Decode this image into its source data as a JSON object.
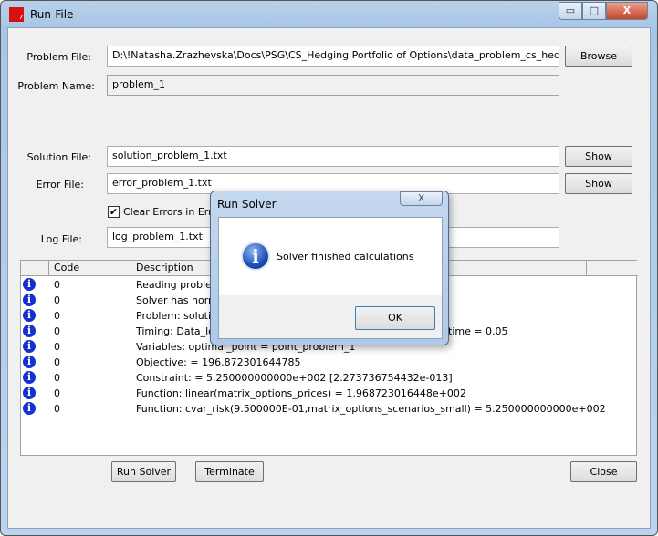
{
  "window": {
    "title": "Run-File",
    "controls": {
      "minimize": "▭",
      "maximize": "□",
      "close": "X"
    }
  },
  "form": {
    "problem_file": {
      "label": "Problem File:",
      "value": "D:\\!Natasha.Zrazhevska\\Docs\\PSG\\CS_Hedging Portfolio of Options\\data_problem_cs_hedging_portfolio"
    },
    "browse_label": "Browse",
    "problem_name": {
      "label": "Problem Name:",
      "value": "problem_1"
    },
    "solution_file": {
      "label": "Solution File:",
      "value": "solution_problem_1.txt"
    },
    "error_file": {
      "label": "Error File:",
      "value": "error_problem_1.txt"
    },
    "show_label": "Show",
    "clear_errors": {
      "label": "Clear Errors in Error",
      "checked": true
    },
    "log_file": {
      "label": "Log File:",
      "value": "log_problem_1.txt"
    }
  },
  "table": {
    "headers": [
      "",
      "Code",
      "Description",
      ""
    ],
    "rows": [
      {
        "icon": "info-icon",
        "code": "0",
        "description": "Reading problem"
      },
      {
        "icon": "info-icon",
        "code": "0",
        "description": "Solver has norma"
      },
      {
        "icon": "info-icon",
        "code": "0",
        "description": "Problem: solution"
      },
      {
        "icon": "info-icon",
        "code": "0",
        "description": "Timing: Data_loa",
        "description_tail": "time = 0.05"
      },
      {
        "icon": "info-icon",
        "code": "0",
        "description": "Variables: optimal_point = point_problem_1"
      },
      {
        "icon": "info-icon",
        "code": "0",
        "description": "Objective:    = 196.872301644785"
      },
      {
        "icon": "info-icon",
        "code": "0",
        "description": "Constraint:  = 5.250000000000e+002 [2.273736754432e-013]"
      },
      {
        "icon": "info-icon",
        "code": "0",
        "description": "Function: linear(matrix_options_prices) = 1.968723016448e+002"
      },
      {
        "icon": "info-icon",
        "code": "0",
        "description": "Function: cvar_risk(9.500000E-01,matrix_options_scenarios_small) = 5.250000000000e+002"
      }
    ]
  },
  "buttons": {
    "run_solver": "Run Solver",
    "terminate": "Terminate",
    "close": "Close"
  },
  "dialog": {
    "title": "Run Solver",
    "message": "Solver finished calculations",
    "ok": "OK",
    "close": "X",
    "icon": "info-icon"
  }
}
